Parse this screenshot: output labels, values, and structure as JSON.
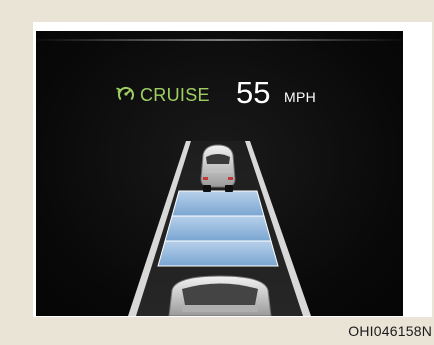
{
  "display": {
    "cruise_icon": "cruise-control-icon",
    "cruise_label": "CRUISE",
    "speed_value": "55",
    "speed_unit": "MPH"
  },
  "caption": {
    "code": "OHI046158N"
  },
  "colors": {
    "cruise_green": "#9fcf62",
    "gap_bar_blue": "#8db5dc",
    "screen_background": "#0b0b0b",
    "page_background": "#e9e4d6"
  },
  "following_distance": {
    "bars_shown": 3
  }
}
